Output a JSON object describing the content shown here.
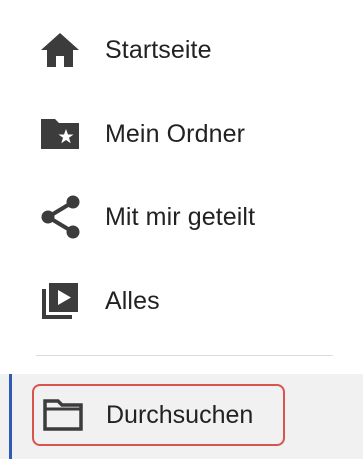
{
  "nav": {
    "items": [
      {
        "label": "Startseite",
        "icon": "home-icon"
      },
      {
        "label": "Mein Ordner",
        "icon": "folder-star-icon"
      },
      {
        "label": "Mit mir geteilt",
        "icon": "share-icon"
      },
      {
        "label": "Alles",
        "icon": "video-library-icon"
      }
    ],
    "browse": {
      "label": "Durchsuchen",
      "icon": "folder-outline-icon",
      "active": true
    }
  },
  "colors": {
    "icon": "#3c3c3c",
    "active_bar": "#2f5bb7",
    "highlight_border": "#d9534f",
    "active_background": "#f1f1f1",
    "divider": "#dadce0"
  }
}
